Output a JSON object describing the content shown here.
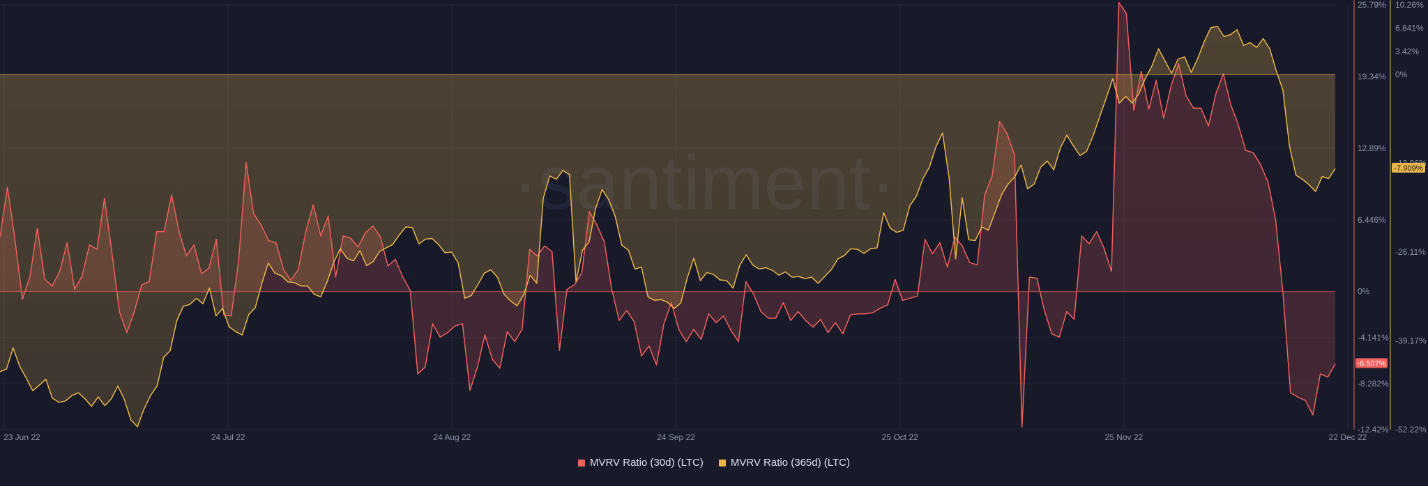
{
  "watermark": "·santiment·",
  "colors": {
    "background": "#181a2a",
    "series_30d": "#f0605c",
    "series_365d": "#e8b64a",
    "grid": "#24273a",
    "tick_text": "#8d92a6"
  },
  "legend": {
    "items": [
      {
        "label": "MVRV Ratio (30d) (LTC)",
        "color": "#f0605c"
      },
      {
        "label": "MVRV Ratio (365d) (LTC)",
        "color": "#e8b64a"
      }
    ]
  },
  "chart_data": {
    "type": "area",
    "x_axis": {
      "start": "23 Jun 22",
      "end": "22 Dec 22",
      "tick_labels": [
        "23 Jun 22",
        "24 Jul 22",
        "24 Aug 22",
        "24 Sep 22",
        "25 Oct 22",
        "25 Nov 22",
        "22 Dec 22"
      ]
    },
    "left_axis": {
      "series": "MVRV Ratio (30d) (LTC)",
      "range": [
        -12.42,
        25.79
      ],
      "tick_labels": [
        "25.79%",
        "19.34%",
        "12.89%",
        "6.446%",
        "0%",
        "-4.141%",
        "-8.282%",
        "-12.42%"
      ],
      "tick_values": [
        25.79,
        19.34,
        12.89,
        6.446,
        0,
        -4.141,
        -8.282,
        -12.42
      ]
    },
    "right_axis": {
      "series": "MVRV Ratio (365d) (LTC)",
      "range": [
        -52.22,
        10.26
      ],
      "tick_labels": [
        "10.26%",
        "6.841%",
        "3.42%",
        "0%",
        "-7.909%",
        "-13.06%",
        "-26.11%",
        "-39.17%",
        "-52.22%"
      ],
      "tick_values": [
        10.26,
        6.841,
        3.42,
        0,
        -13.06,
        -26.11,
        -39.17,
        -52.22
      ]
    },
    "last_value_labels": {
      "series_30d": "-6.507%",
      "series_365d": "-7.909%"
    },
    "series": [
      {
        "name": "MVRV Ratio (30d) (LTC)",
        "axis": "left",
        "color": "#f0605c",
        "values": [
          4.9,
          9.4,
          4.7,
          -0.7,
          1.3,
          5.7,
          1.1,
          0.5,
          1.8,
          4.4,
          0.2,
          1.4,
          4.2,
          3.8,
          8.4,
          3.5,
          -1.8,
          -3.7,
          -1.8,
          0.6,
          0.9,
          5.4,
          5.4,
          8.7,
          5.4,
          3.2,
          4.2,
          1.6,
          2.1,
          4.7,
          -2.1,
          -2.2,
          2.8,
          11.6,
          7.0,
          6.0,
          4.6,
          4.4,
          2.0,
          1.0,
          2.0,
          5.4,
          7.8,
          5.0,
          6.8,
          1.3,
          5.0,
          4.8,
          4.0,
          5.3,
          5.9,
          4.9,
          2.3,
          2.9,
          1.3,
          0.1,
          -7.4,
          -6.8,
          -2.9,
          -4.1,
          -3.7,
          -3.1,
          -2.9,
          -8.9,
          -6.8,
          -3.9,
          -6.1,
          -6.9,
          -3.6,
          -4.5,
          -3.4,
          3.8,
          3.2,
          4.1,
          3.6,
          -5.3,
          0.2,
          0.6,
          1.7,
          7.2,
          6.0,
          4.5,
          0.2,
          -2.6,
          -1.7,
          -2.7,
          -5.8,
          -4.9,
          -6.6,
          -2.9,
          -1.0,
          -3.4,
          -4.5,
          -3.4,
          -4.3,
          -2.0,
          -2.8,
          -2.2,
          -3.5,
          -4.5,
          0.9,
          -0.2,
          -1.8,
          -2.4,
          -2.4,
          -1.0,
          -2.6,
          -1.8,
          -2.6,
          -3.2,
          -2.5,
          -3.7,
          -2.8,
          -3.8,
          -2.1,
          -2.0,
          -2.0,
          -1.9,
          -1.5,
          -1.2,
          1.1,
          -0.8,
          -0.6,
          -0.4,
          4.7,
          3.4,
          4.4,
          2.2,
          4.9,
          4.1,
          2.6,
          2.4,
          8.7,
          10.4,
          15.3,
          14.2,
          12.3,
          -12.2,
          1.3,
          1.2,
          -1.7,
          -3.8,
          -4.1,
          -1.8,
          -2.5,
          5.0,
          4.3,
          5.4,
          3.9,
          1.8,
          26.0,
          25.0,
          16.3,
          19.8,
          16.4,
          19.0,
          15.6,
          18.5,
          20.5,
          17.6,
          16.5,
          16.5,
          14.9,
          17.8,
          19.6,
          16.8,
          15.0,
          12.7,
          12.5,
          11.4,
          9.8,
          6.5,
          -0.2,
          -9.1,
          -9.5,
          -9.8,
          -11.1,
          -7.4,
          -7.7,
          -6.5
        ]
      },
      {
        "name": "MVRV Ratio (365d) (LTC)",
        "axis": "right",
        "color": "#e8b64a",
        "values": [
          -43.7,
          -43.3,
          -40.2,
          -42.9,
          -44.6,
          -46.5,
          -45.7,
          -44.8,
          -47.6,
          -48.2,
          -48.0,
          -47.2,
          -46.8,
          -47.7,
          -48.8,
          -47.4,
          -48.7,
          -47.7,
          -45.8,
          -47.8,
          -50.8,
          -51.8,
          -49.2,
          -47.2,
          -45.8,
          -41.6,
          -40.6,
          -36.2,
          -34.1,
          -33.8,
          -32.9,
          -33.7,
          -31.4,
          -35.5,
          -34.4,
          -37.1,
          -37.8,
          -38.3,
          -35.3,
          -34.3,
          -30.7,
          -27.7,
          -29.2,
          -29.6,
          -30.5,
          -30.6,
          -31.1,
          -31.1,
          -32.3,
          -32.7,
          -30.4,
          -27.6,
          -25.6,
          -27.0,
          -27.4,
          -25.9,
          -28.1,
          -27.5,
          -26.0,
          -25.5,
          -25.0,
          -23.6,
          -22.4,
          -22.5,
          -24.9,
          -24.2,
          -24.1,
          -25.0,
          -26.2,
          -26.1,
          -27.7,
          -32.9,
          -32.5,
          -30.9,
          -29.2,
          -28.7,
          -29.8,
          -32.3,
          -33.3,
          -34.0,
          -32.4,
          -29.5,
          -30.7,
          -18.2,
          -14.9,
          -15.4,
          -14.1,
          -14.7,
          -30.5,
          -25.8,
          -24.6,
          -19.7,
          -16.9,
          -18.4,
          -20.9,
          -25.1,
          -25.8,
          -28.6,
          -28.3,
          -32.7,
          -33.2,
          -33.1,
          -33.5,
          -34.4,
          -33.6,
          -29.9,
          -27.0,
          -30.3,
          -29.1,
          -29.4,
          -30.2,
          -30.3,
          -31.4,
          -28.1,
          -26.5,
          -28.0,
          -28.6,
          -28.4,
          -28.8,
          -29.5,
          -29.0,
          -29.8,
          -29.7,
          -30.0,
          -29.8,
          -30.7,
          -29.7,
          -28.7,
          -27.1,
          -26.6,
          -25.6,
          -25.7,
          -26.3,
          -25.6,
          -25.5,
          -20.3,
          -22.6,
          -23.2,
          -22.9,
          -19.3,
          -17.9,
          -15.3,
          -13.6,
          -10.6,
          -8.6,
          -15.2,
          -27.1,
          -18.1,
          -24.3,
          -24.4,
          -22.4,
          -22.9,
          -20.3,
          -17.7,
          -16.1,
          -15.1,
          -13.3,
          -16.8,
          -16.1,
          -13.6,
          -12.7,
          -14.0,
          -10.8,
          -8.9,
          -10.5,
          -11.9,
          -11.3,
          -9.0,
          -6.2,
          -3.5,
          -0.6,
          -4.2,
          -3.2,
          -4.2,
          -2.8,
          -0.5,
          1.3,
          3.8,
          2.0,
          0.2,
          2.3,
          2.6,
          0.3,
          2.4,
          4.9,
          6.9,
          7.1,
          5.6,
          5.9,
          6.6,
          4.3,
          4.7,
          4.0,
          5.3,
          3.8,
          0.5,
          -2.3,
          -10.5,
          -14.8,
          -15.4,
          -16.2,
          -17.2,
          -15.0,
          -15.3,
          -13.8
        ]
      }
    ]
  }
}
